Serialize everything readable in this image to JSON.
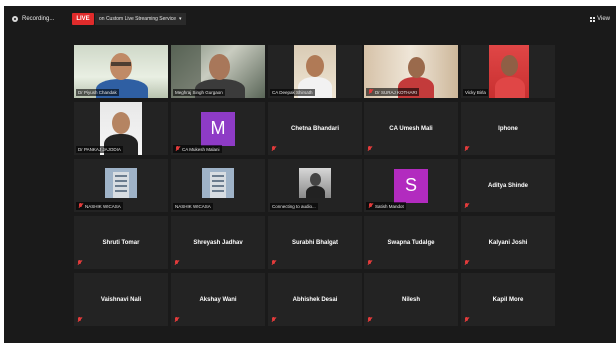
{
  "topbar": {
    "recording_label": "Recording...",
    "live_label": "LIVE",
    "service_label": "on Custom Live Streaming Service",
    "view_label": "View"
  },
  "colors": {
    "live": "#e02b2b",
    "active_speaker": "#c7d93a",
    "muted_mic": "#e23b3b",
    "avatar_m": "#8e3bc6",
    "avatar_s": "#b22bbf"
  },
  "participants": [
    {
      "caption": "Dr Piyush Chandak",
      "kind": "video",
      "muted": false
    },
    {
      "caption": "Meghraj Singh Gurgaon",
      "kind": "video",
      "muted": false
    },
    {
      "caption": "CA Deepak Shirsath",
      "kind": "video",
      "muted": false
    },
    {
      "caption": "Dr SURAJ KOTHARI",
      "kind": "video",
      "muted": true
    },
    {
      "caption": "Vicky Birla",
      "kind": "video",
      "muted": false
    },
    {
      "caption": "Dr PANKAJ JAJODIA",
      "kind": "video",
      "muted": false
    },
    {
      "caption": "CA Mukesh Malani",
      "kind": "avatar",
      "initial": "M",
      "muted": true
    },
    {
      "name": "Chetna Bhandari",
      "kind": "name",
      "muted": true
    },
    {
      "name": "CA Umesh Mali",
      "kind": "name",
      "muted": true
    },
    {
      "name": "Iphone",
      "kind": "name",
      "muted": true
    },
    {
      "caption": "NASHIK WICASA",
      "kind": "building",
      "muted": true
    },
    {
      "caption": "NASHIK WICASA",
      "kind": "building",
      "muted": false
    },
    {
      "caption": "Connecting to audio...",
      "kind": "photo",
      "muted": false
    },
    {
      "caption": "Satish Mandot",
      "kind": "avatar",
      "initial": "S",
      "muted": true
    },
    {
      "name": "Aditya Shinde",
      "kind": "name",
      "muted": true
    },
    {
      "name": "Shruti Tomar",
      "kind": "name",
      "muted": true
    },
    {
      "name": "Shreyash Jadhav",
      "kind": "name",
      "muted": true
    },
    {
      "name": "Surabhi Bhalgat",
      "kind": "name",
      "muted": true
    },
    {
      "name": "Swapna Tudalge",
      "kind": "name",
      "muted": true
    },
    {
      "name": "Kalyani Joshi",
      "kind": "name",
      "muted": true
    },
    {
      "name": "Vaishnavi Nali",
      "kind": "name",
      "muted": true
    },
    {
      "name": "Akshay Wani",
      "kind": "name",
      "muted": true
    },
    {
      "name": "Abhishek Desai",
      "kind": "name",
      "muted": true
    },
    {
      "name": "Nilesh",
      "kind": "name",
      "muted": true
    },
    {
      "name": "Kapil More",
      "kind": "name",
      "muted": true
    }
  ]
}
